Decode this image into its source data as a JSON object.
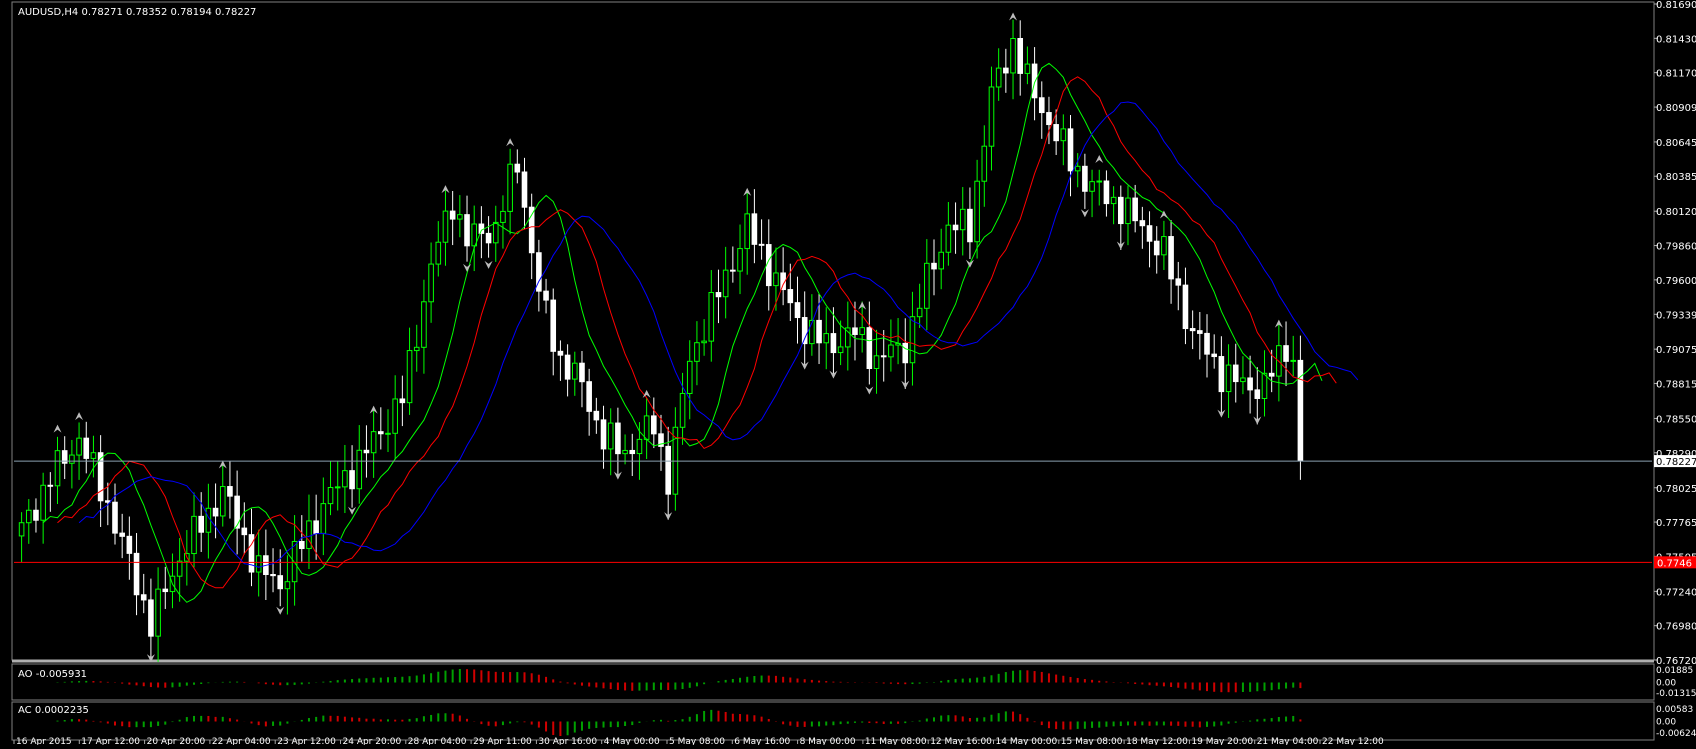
{
  "main_panel": {
    "title": "AUDUSD,H4  0.78271 0.78352 0.78194 0.78227",
    "current_price_label": "0.78227",
    "red_line_label": "0.7746",
    "price_axis_labels": [
      "0.81690",
      "0.81430",
      "0.81170",
      "0.80909",
      "0.80645",
      "0.80385",
      "0.80120",
      "0.79860",
      "0.79600",
      "0.79339",
      "0.79075",
      "0.78815",
      "0.78550",
      "0.78290",
      "0.78025",
      "0.77765",
      "0.77505",
      "0.77240",
      "0.76980",
      "0.76720"
    ]
  },
  "ao_panel": {
    "title": "AO -0.005931",
    "axis_labels": [
      "0.01885",
      "0.00",
      "-0.01315"
    ]
  },
  "ac_panel": {
    "title": "AC 0.0002235",
    "axis_labels": [
      "0.00583",
      "0.00",
      "-0.00624"
    ]
  },
  "time_axis_labels": [
    "16 Apr 2015",
    "17 Apr 12:00",
    "20 Apr 20:00",
    "22 Apr 04:00",
    "23 Apr 12:00",
    "24 Apr 20:00",
    "28 Apr 04:00",
    "29 Apr 11:00",
    "30 Apr 16:00",
    "4 May 00:00",
    "5 May 08:00",
    "6 May 16:00",
    "8 May 00:00",
    "11 May 08:00",
    "12 May 16:00",
    "14 May 00:00",
    "15 May 08:00",
    "18 May 12:00",
    "19 May 20:00",
    "21 May 04:00",
    "22 May 12:00"
  ],
  "colors": {
    "bull_candle": "#00ff00",
    "bear_candle": "#ffffff",
    "alligator_lips": "#00ff00",
    "alligator_teeth": "#ff0000",
    "alligator_jaw": "#0000ff",
    "ao_up": "#00a000",
    "ao_down": "#d00000",
    "panel_border": "#808080",
    "text": "#ffffff"
  },
  "chart_data": {
    "type": "candlestick",
    "symbol": "AUDUSD",
    "timeframe": "H4",
    "ylim": [
      0.7672,
      0.8169
    ],
    "current_price": 0.78227,
    "horizontal_line": 0.7746,
    "anchors": [
      [
        0,
        0.777
      ],
      [
        4,
        0.781
      ],
      [
        8,
        0.784
      ],
      [
        12,
        0.779
      ],
      [
        16,
        0.773
      ],
      [
        18,
        0.77
      ],
      [
        22,
        0.775
      ],
      [
        28,
        0.78
      ],
      [
        33,
        0.774
      ],
      [
        36,
        0.773
      ],
      [
        42,
        0.779
      ],
      [
        48,
        0.783
      ],
      [
        53,
        0.787
      ],
      [
        57,
        0.797
      ],
      [
        60,
        0.802
      ],
      [
        62,
        0.799
      ],
      [
        66,
        0.8
      ],
      [
        69,
        0.805
      ],
      [
        72,
        0.795
      ],
      [
        75,
        0.79
      ],
      [
        78,
        0.788
      ],
      [
        81,
        0.784
      ],
      [
        84,
        0.783
      ],
      [
        88,
        0.785
      ],
      [
        90,
        0.781
      ],
      [
        93,
        0.79
      ],
      [
        97,
        0.795
      ],
      [
        101,
        0.8
      ],
      [
        104,
        0.797
      ],
      [
        108,
        0.793
      ],
      [
        112,
        0.791
      ],
      [
        116,
        0.792
      ],
      [
        119,
        0.79
      ],
      [
        123,
        0.791
      ],
      [
        126,
        0.796
      ],
      [
        129,
        0.8
      ],
      [
        132,
        0.8
      ],
      [
        135,
        0.81
      ],
      [
        138,
        0.814
      ],
      [
        140,
        0.811
      ],
      [
        143,
        0.808
      ],
      [
        146,
        0.805
      ],
      [
        149,
        0.803
      ],
      [
        152,
        0.802
      ],
      [
        156,
        0.8
      ],
      [
        159,
        0.798
      ],
      [
        163,
        0.792
      ],
      [
        167,
        0.789
      ],
      [
        170,
        0.788
      ],
      [
        173,
        0.788
      ],
      [
        176,
        0.791
      ],
      [
        177,
        0.79
      ],
      [
        178,
        0.7823
      ]
    ],
    "series": [
      {
        "name": "AO",
        "value": -0.005931
      },
      {
        "name": "AC",
        "value": 0.0002235
      }
    ]
  }
}
